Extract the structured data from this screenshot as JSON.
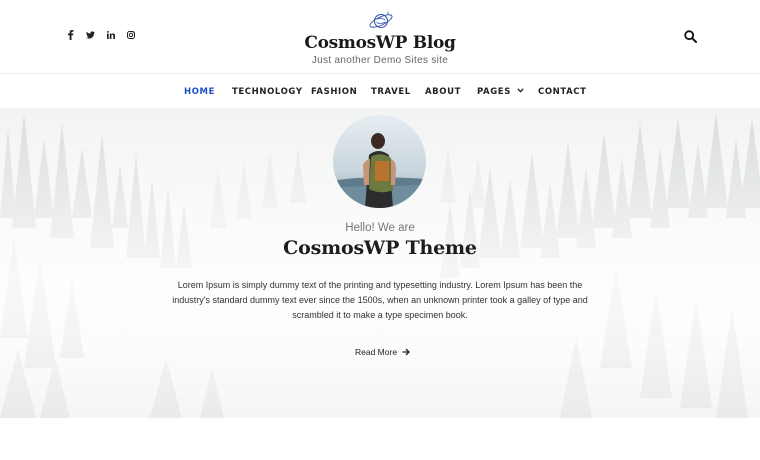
{
  "header": {
    "site_title": "CosmosWP Blog",
    "tagline": "Just another Demo Sites site",
    "social_icons": [
      "facebook-icon",
      "twitter-icon",
      "linkedin-icon",
      "instagram-icon"
    ],
    "search_icon": "search-icon"
  },
  "nav": {
    "items": [
      {
        "label": "HOME",
        "active": true
      },
      {
        "label": "TECHNOLOGY"
      },
      {
        "label": "FASHION"
      },
      {
        "label": "TRAVEL"
      },
      {
        "label": "ABOUT"
      },
      {
        "label": "PAGES",
        "has_dropdown": true
      },
      {
        "label": "CONTACT"
      }
    ],
    "active_color": "#1e4fc8"
  },
  "hero": {
    "greeting": "Hello! We are",
    "title": "CosmosWP Theme",
    "text": "Lorem Ipsum is simply dummy text of the printing and typesetting industry. Lorem Ipsum has been the industry's standard dummy text ever since the 1500s, when an unknown printer took a galley of type and scrambled it to make a type specimen book.",
    "read_more": "Read More"
  }
}
